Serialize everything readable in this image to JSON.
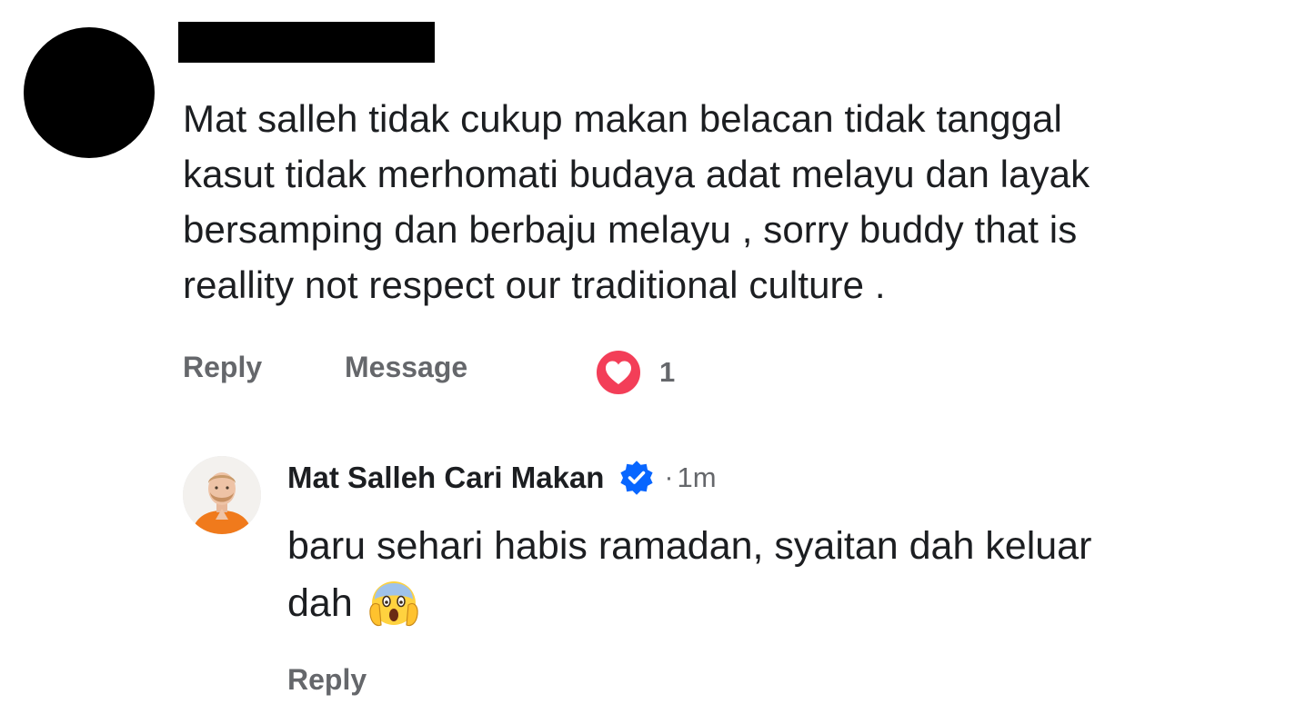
{
  "comment": {
    "author_redacted": true,
    "text_lines": [
      "Mat salleh tidak cukup makan belacan tidak tanggal",
      "kasut tidak merhomati budaya adat melayu dan layak",
      "bersamping dan berbaju melayu , sorry buddy that is",
      "reallity not respect our traditional culture ."
    ],
    "actions": {
      "reply_label": "Reply",
      "message_label": "Message"
    },
    "reaction": {
      "icon": "heart-reaction-icon",
      "count": "1",
      "color": "#f33e58"
    }
  },
  "reply": {
    "author_name": "Mat Salleh Cari Makan",
    "verified_icon": "verified-badge-icon",
    "verified_color": "#0866ff",
    "separator": "·",
    "timestamp": "1m",
    "text_line1": "baru sehari habis ramadan, syaitan dah keluar",
    "text_line2": "dah",
    "emoji": "face-screaming-hands-emoji",
    "reply_label": "Reply"
  }
}
